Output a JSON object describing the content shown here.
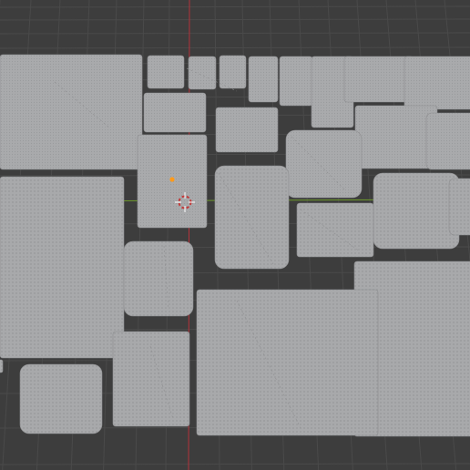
{
  "viewport": {
    "colors": {
      "background": "#3d3d3d",
      "grid_line": "#4a4a4a",
      "grid_line_major": "#525252",
      "y_axis": "#b4323a",
      "x_axis": "#6e9a2c",
      "plate_fill": "#a8a9ab",
      "plate_stud": "#9a9b9d",
      "plate_edge": "#8c8d8f",
      "origin_dot": "#ff9a1a",
      "cursor_ring": "#c23a3a",
      "cursor_cross": "#ffffff"
    },
    "scene_object": "baseplates",
    "cursor_icon": "3d-cursor-icon",
    "origin_icon": "object-origin-icon"
  }
}
